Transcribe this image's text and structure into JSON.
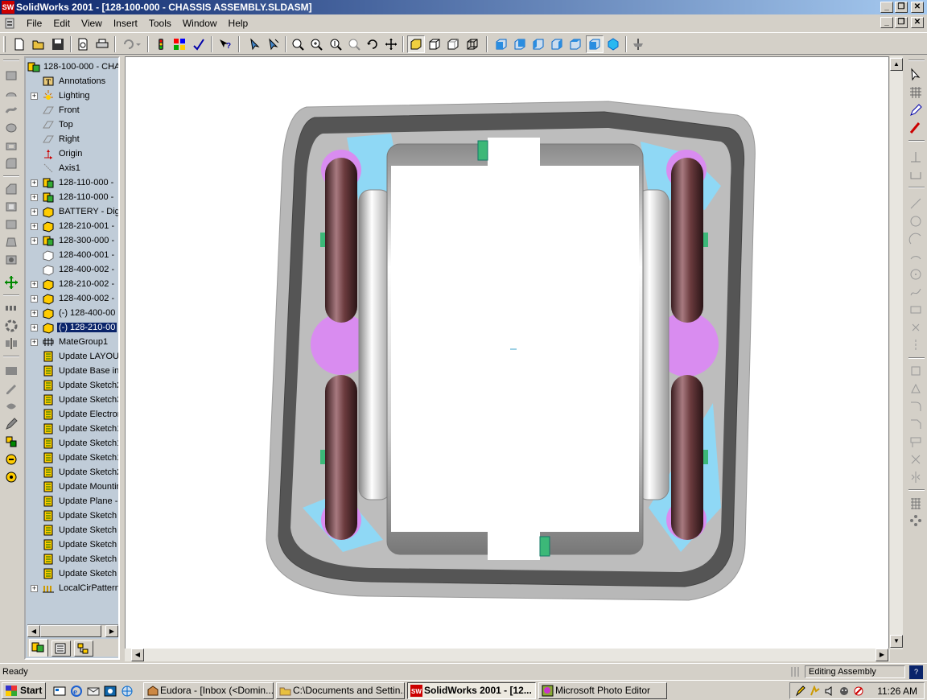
{
  "window": {
    "title": "SolidWorks 2001 - [128-100-000 - CHASSIS ASSEMBLY.SLDASM]",
    "app_icon_text": "SW"
  },
  "menu": [
    "File",
    "Edit",
    "View",
    "Insert",
    "Tools",
    "Window",
    "Help"
  ],
  "toolbar": {
    "buttons": [
      "new-icon",
      "open-icon",
      "save-icon",
      "print-preview-icon",
      "print-icon",
      "undo-icon",
      "traffic-light-icon",
      "color-icon",
      "spelling-icon",
      "whats-this-icon",
      "select-icon",
      "filter-icon",
      "zoom-fit-icon",
      "zoom-area-icon",
      "zoom-inout-icon",
      "zoom-selection-icon",
      "rotate-icon",
      "pan-icon",
      "shaded-icon",
      "hidden-removed-icon",
      "hidden-gray-icon",
      "wireframe-icon",
      "view-front-icon",
      "view-back-icon",
      "view-left-icon",
      "view-right-icon",
      "view-top-icon",
      "view-iso-icon",
      "section-view-icon"
    ]
  },
  "tree": {
    "root": "128-100-000 - CHA",
    "items": [
      {
        "label": "Annotations",
        "icon": "annotations-icon",
        "expandable": false
      },
      {
        "label": "Lighting",
        "icon": "lighting-icon",
        "expandable": true
      },
      {
        "label": "Front",
        "icon": "plane-icon",
        "expandable": false
      },
      {
        "label": "Top",
        "icon": "plane-icon",
        "expandable": false
      },
      {
        "label": "Right",
        "icon": "plane-icon",
        "expandable": false
      },
      {
        "label": "Origin",
        "icon": "origin-icon",
        "expandable": false
      },
      {
        "label": "Axis1",
        "icon": "axis-icon",
        "expandable": false
      },
      {
        "label": "128-110-000 -",
        "icon": "subassembly-icon",
        "expandable": true
      },
      {
        "label": "128-110-000 -",
        "icon": "subassembly-icon",
        "expandable": true
      },
      {
        "label": "BATTERY -  Dig",
        "icon": "part-icon",
        "expandable": true
      },
      {
        "label": "128-210-001 -",
        "icon": "part-icon",
        "expandable": true
      },
      {
        "label": "128-300-000 -",
        "icon": "subassembly-icon",
        "expandable": true
      },
      {
        "label": "128-400-001 -",
        "icon": "part-hidden-icon",
        "expandable": false
      },
      {
        "label": "128-400-002 -",
        "icon": "part-hidden-icon",
        "expandable": false
      },
      {
        "label": "128-210-002 -",
        "icon": "part-icon",
        "expandable": true
      },
      {
        "label": "128-400-002 -",
        "icon": "part-icon",
        "expandable": true
      },
      {
        "label": "(-) 128-400-00",
        "icon": "part-icon",
        "expandable": true
      },
      {
        "label": "(-) 128-210-00",
        "icon": "part-icon",
        "expandable": true,
        "selected": true
      },
      {
        "label": "MateGroup1",
        "icon": "mates-icon",
        "expandable": true
      },
      {
        "label": "Update LAYOUT",
        "icon": "update-icon",
        "expandable": false
      },
      {
        "label": "Update Base in",
        "icon": "update-icon",
        "expandable": false
      },
      {
        "label": "Update Sketch2",
        "icon": "update-icon",
        "expandable": false
      },
      {
        "label": "Update Sketch3",
        "icon": "update-icon",
        "expandable": false
      },
      {
        "label": "Update Electron",
        "icon": "update-icon",
        "expandable": false
      },
      {
        "label": "Update Sketch1",
        "icon": "update-icon",
        "expandable": false
      },
      {
        "label": "Update Sketch1",
        "icon": "update-icon",
        "expandable": false
      },
      {
        "label": "Update Sketch1",
        "icon": "update-icon",
        "expandable": false
      },
      {
        "label": "Update Sketch2",
        "icon": "update-icon",
        "expandable": false
      },
      {
        "label": "Update Mountin",
        "icon": "update-icon",
        "expandable": false
      },
      {
        "label": "Update Plane -",
        "icon": "update-icon",
        "expandable": false
      },
      {
        "label": "Update Sketch",
        "icon": "update-icon",
        "expandable": false
      },
      {
        "label": "Update Sketch",
        "icon": "update-icon",
        "expandable": false
      },
      {
        "label": "Update Sketch",
        "icon": "update-icon",
        "expandable": false
      },
      {
        "label": "Update Sketch",
        "icon": "update-icon",
        "expandable": false
      },
      {
        "label": "Update Sketch",
        "icon": "update-icon",
        "expandable": false
      },
      {
        "label": "LocalCirPattern",
        "icon": "pattern-icon",
        "expandable": true
      }
    ]
  },
  "status": {
    "left": "Ready",
    "mode": "Editing Assembly"
  },
  "taskbar": {
    "start": "Start",
    "tasks": [
      {
        "label": "Eudora - [Inbox (<Domin...",
        "active": false
      },
      {
        "label": "C:\\Documents and Settin...",
        "active": false
      },
      {
        "label": "SolidWorks 2001 - [12...",
        "active": true
      },
      {
        "label": "Microsoft Photo Editor",
        "active": false
      }
    ],
    "clock": "11:26 AM"
  },
  "colors": {
    "title_start": "#0a246a",
    "tree_bg": "#c0ccd8",
    "selection": "#0a246a",
    "wheel": "#6b3b3e",
    "bracket": "#8fd8f5",
    "hub": "#d98cf0"
  }
}
